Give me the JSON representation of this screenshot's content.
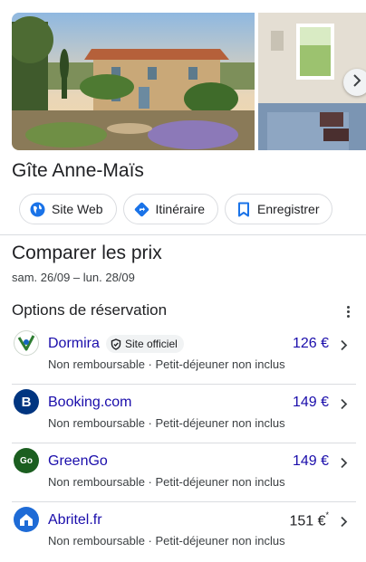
{
  "listing": {
    "title": "Gîte Anne-Maïs"
  },
  "actions": {
    "website": "Site Web",
    "directions": "Itinéraire",
    "save": "Enregistrer"
  },
  "compare": {
    "title": "Comparer les prix",
    "dates": "sam. 26/09 – lun. 28/09"
  },
  "booking": {
    "title": "Options de réservation",
    "offers": [
      {
        "provider": "Dormira",
        "badge": "Site officiel",
        "price": "126 €",
        "details": "Non remboursable · Petit-déjeuner non inclus",
        "logo_color": "#2e7d32"
      },
      {
        "provider": "Booking.com",
        "price": "149 €",
        "details": "Non remboursable · Petit-déjeuner non inclus",
        "logo_color": "#003580",
        "logo_text": "B"
      },
      {
        "provider": "GreenGo",
        "price": "149 €",
        "details": "Non remboursable · Petit-déjeuner non inclus",
        "logo_color": "#1b5e20",
        "logo_text": "Go"
      },
      {
        "provider": "Abritel.fr",
        "price": "151 €",
        "price_mark": "*",
        "details": "Non remboursable · Petit-déjeuner non inclus",
        "logo_color": "#1e6bd6"
      }
    ]
  },
  "colors": {
    "link": "#1a0dab",
    "accent_blue": "#1a73e8",
    "text": "#202124",
    "secondary_text": "#3c4043",
    "divider": "#dadce0"
  }
}
